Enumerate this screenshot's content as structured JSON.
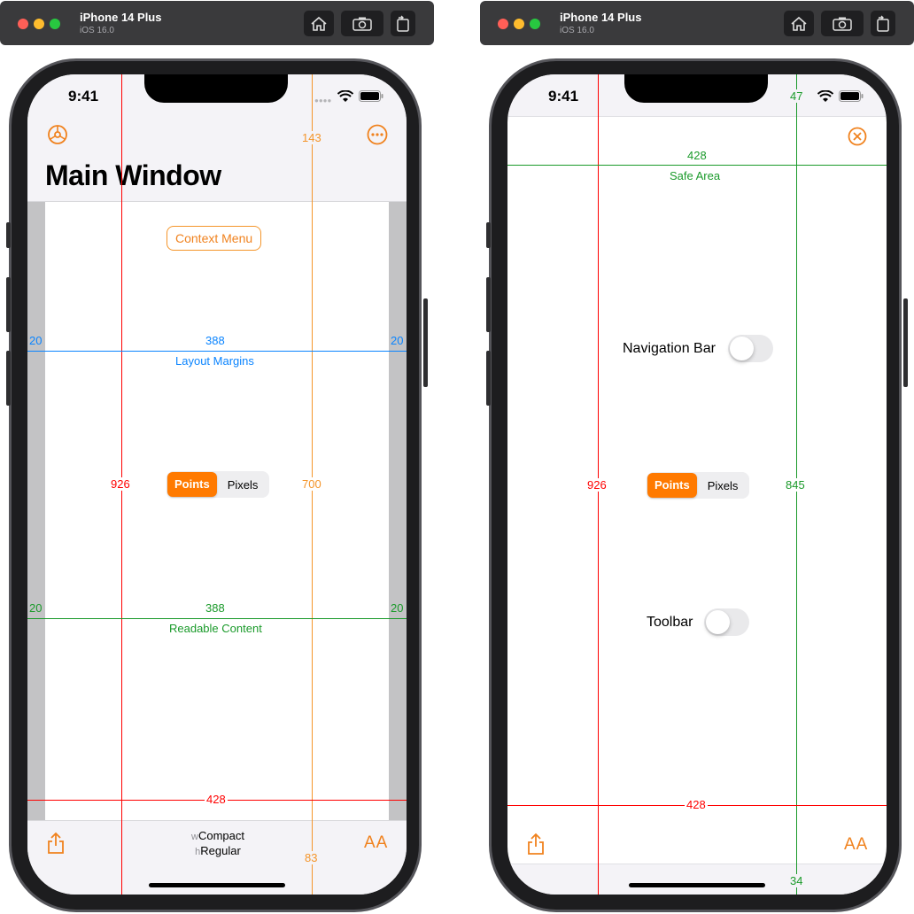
{
  "colors": {
    "accent": "#ff7a00",
    "red": "#ff0000",
    "blue": "#0a84ff",
    "green": "#1a9a2a",
    "orange_measure": "#f4952a"
  },
  "left": {
    "window": {
      "title": "iPhone 14 Plus",
      "subtitle": "iOS 16.0",
      "buttons": [
        "home-icon",
        "screenshot-icon",
        "rotate-icon"
      ]
    },
    "status": {
      "time": "9:41"
    },
    "nav": {
      "title": "Main Window",
      "left_icon": "gear-icon",
      "right_icon": "ellipsis-circle-icon"
    },
    "context_menu_label": "Context Menu",
    "segment": {
      "selected": "Points",
      "other": "Pixels"
    },
    "measures": {
      "screen_height": "926",
      "nav_height": "143",
      "content_height": "700",
      "toolbar_height": "83",
      "screen_width": "428",
      "layout_margin_left": "20",
      "layout_margin_width": "388",
      "layout_margin_right": "20",
      "layout_margin_label": "Layout Margins",
      "readable_left": "20",
      "readable_width": "388",
      "readable_right": "20",
      "readable_label": "Readable Content"
    },
    "size_class": {
      "w_prefix": "w",
      "w_value": "Compact",
      "h_prefix": "h",
      "h_value": "Regular"
    },
    "toolbar": {
      "left_icon": "share-icon",
      "right_icon": "text-size-icon",
      "right_text": "AA"
    }
  },
  "right": {
    "window": {
      "title": "iPhone 14 Plus",
      "subtitle": "iOS 16.0",
      "buttons": [
        "home-icon",
        "screenshot-icon",
        "rotate-icon"
      ]
    },
    "status": {
      "time": "9:41"
    },
    "close_icon": "close-circle-icon",
    "measures": {
      "safe_top": "47",
      "screen_width_top": "428",
      "safe_area_label": "Safe Area",
      "screen_height": "926",
      "safe_height": "845",
      "screen_width_bottom": "428",
      "safe_bottom": "34"
    },
    "nav_toggle_label": "Navigation Bar",
    "toolbar_toggle_label": "Toolbar",
    "segment": {
      "selected": "Points",
      "other": "Pixels"
    },
    "toolbar": {
      "left_icon": "share-icon",
      "right_icon": "text-size-icon",
      "right_text": "AA"
    }
  }
}
